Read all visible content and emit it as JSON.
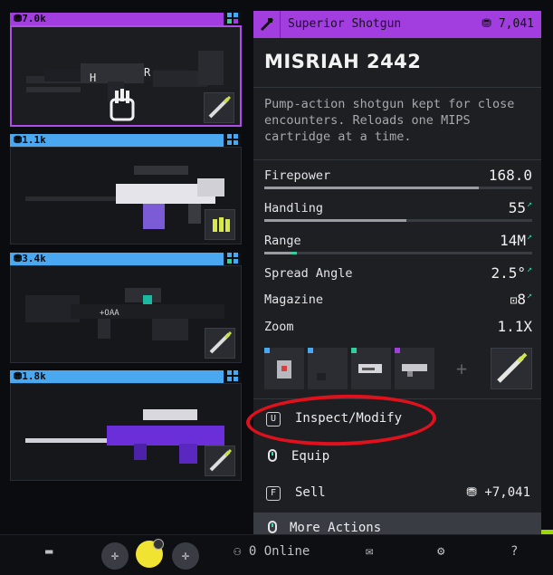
{
  "colors": {
    "exotic": "#a23ee0",
    "rare": "#4aa8f0",
    "stat_gain": "#31cf9c",
    "annotation_circle": "#e0111c"
  },
  "weapons": [
    {
      "price": "7.0k",
      "tier_color": "#a23ee0",
      "selected": true
    },
    {
      "price": "1.1k",
      "tier_color": "#4aa8f0",
      "selected": false
    },
    {
      "price": "3.4k",
      "tier_color": "#4aa8f0",
      "selected": false
    },
    {
      "price": "1.8k",
      "tier_color": "#4aa8f0",
      "selected": false
    }
  ],
  "detail": {
    "tier_label": "Superior Shotgun",
    "price": "7,041",
    "name": "MISRIAH 2442",
    "description": "Pump-action shotgun kept for close encounters. Reloads one MIPS cartridge at a time.",
    "stats": [
      {
        "label": "Firepower",
        "value": "168.0",
        "level": 0.8,
        "gain": 0.0,
        "arrow": ""
      },
      {
        "label": "Handling",
        "value": "55",
        "level": 0.53,
        "gain": 0.0,
        "arrow": "↗"
      },
      {
        "label": "Range",
        "value": "14M",
        "level": 0.1,
        "gain": 0.02,
        "arrow": "↗"
      },
      {
        "label": "Spread Angle",
        "value": "2.5°",
        "arrow": "↗"
      },
      {
        "label": "Magazine",
        "value": "8",
        "arrow": "↗"
      },
      {
        "label": "Zoom",
        "value": "1.1X",
        "arrow": ""
      }
    ],
    "mod_slot_colors": [
      "#4aa8f0",
      "#4aa8f0",
      "#31cf9c",
      "#a23ee0"
    ],
    "actions": {
      "inspect": {
        "key": "U",
        "label": "Inspect/Modify"
      },
      "equip": {
        "label": "Equip"
      },
      "sell": {
        "key": "F",
        "label": "Sell",
        "amount": "+7,041"
      },
      "more": {
        "label": "More Actions"
      }
    }
  },
  "bottom_bar": {
    "online": "0 Online",
    "icons": [
      "chat-icon",
      "add-icon",
      "avatar",
      "add-icon",
      "friends-icon",
      "mail-icon",
      "gear-icon",
      "help-icon"
    ],
    "help": "?"
  }
}
